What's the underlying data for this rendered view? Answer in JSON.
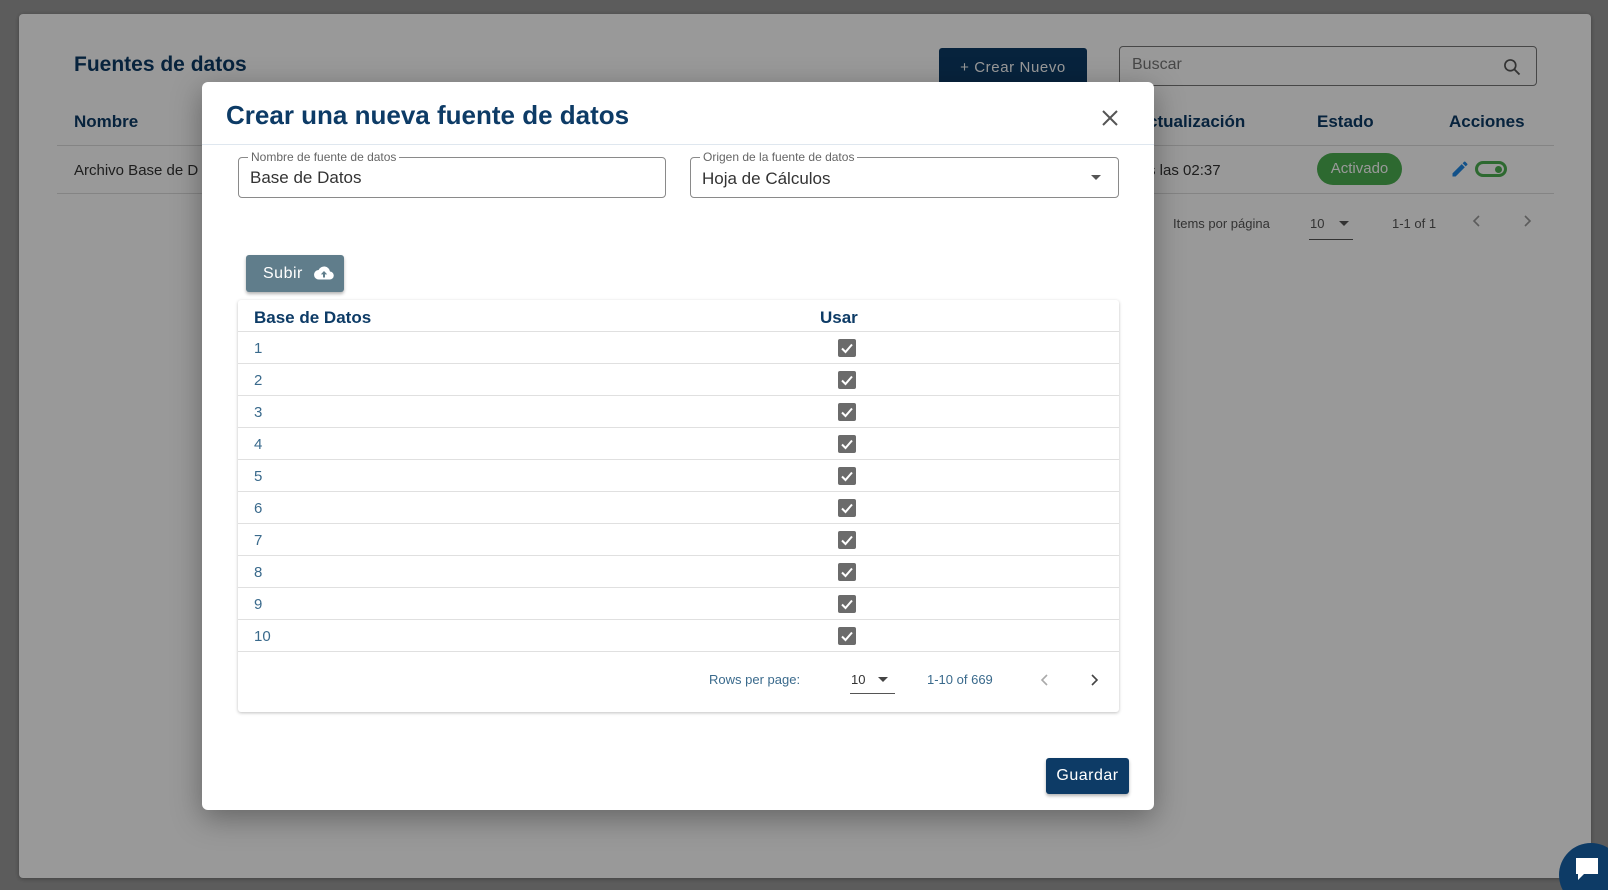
{
  "background": {
    "title": "Fuentes de datos",
    "create_button": "+ Crear Nuevo",
    "search_placeholder": "Buscar",
    "columns": {
      "name": "Nombre",
      "updated": "ctualización",
      "state": "Estado",
      "actions": "Acciones"
    },
    "row": {
      "name": "Archivo Base de D",
      "updated": "s las 02:37",
      "state": "Activado"
    },
    "pagination": {
      "items_label": "Items por página",
      "per_page": "10",
      "range": "1-1 of 1"
    }
  },
  "dialog": {
    "title": "Crear una nueva fuente de datos",
    "name_field": {
      "label": "Nombre de fuente de datos",
      "value": "Base de Datos"
    },
    "origin_field": {
      "label": "Origen de la fuente de datos",
      "value": "Hoja de Cálculos"
    },
    "upload_button": "Subir",
    "table": {
      "headers": [
        "Base de Datos",
        "Usar"
      ],
      "rows": [
        {
          "value": "1",
          "checked": true
        },
        {
          "value": "2",
          "checked": true
        },
        {
          "value": "3",
          "checked": true
        },
        {
          "value": "4",
          "checked": true
        },
        {
          "value": "5",
          "checked": true
        },
        {
          "value": "6",
          "checked": true
        },
        {
          "value": "7",
          "checked": true
        },
        {
          "value": "8",
          "checked": true
        },
        {
          "value": "9",
          "checked": true
        },
        {
          "value": "10",
          "checked": true
        }
      ],
      "footer": {
        "rows_per_page_label": "Rows per page:",
        "rows_per_page": "10",
        "range": "1-10 of 669"
      }
    },
    "save_button": "Guardar"
  },
  "colors": {
    "primary": "#0d3b66",
    "upload": "#607d8b",
    "active_badge": "#4caf50",
    "checkbox": "#6b6b6b"
  }
}
